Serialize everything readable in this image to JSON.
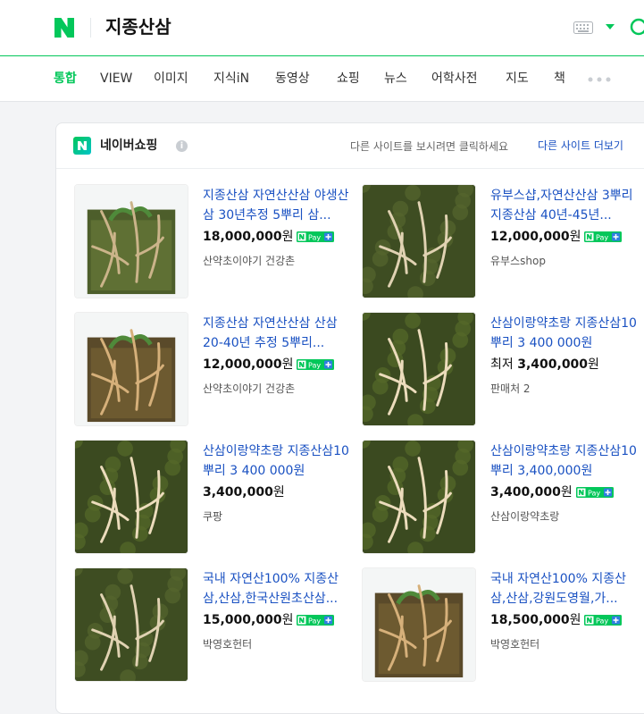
{
  "header": {
    "query": "지종산삼"
  },
  "tabs": [
    "통합",
    "VIEW",
    "이미지",
    "지식iN",
    "동영상",
    "쇼핑",
    "뉴스",
    "어학사전",
    "지도",
    "책"
  ],
  "shopping": {
    "title": "네이버쇼핑",
    "info_glyph": "i",
    "other_sites_hint": "다른 사이트를 보시려면 클릭하세요",
    "other_sites_link": "다른 사이트 더보기",
    "currency": "원",
    "lowest_label": "최저",
    "pay_label": "Pay",
    "products": [
      {
        "title": "지종산삼 자연산산삼 야생산삼 30년추정 5뿌리 삼...",
        "price": "18,000,000",
        "npay": true,
        "lowest": false,
        "seller": "산약초이야기 건강촌"
      },
      {
        "title": "유부스샵,자연산산삼 3뿌리 지종산삼 40년-45년...",
        "price": "12,000,000",
        "npay": true,
        "lowest": false,
        "seller": "유부스shop"
      },
      {
        "title": "지종산삼 자연산산삼 산삼 20-40년 추정 5뿌리...",
        "price": "12,000,000",
        "npay": true,
        "lowest": false,
        "seller": "산약초이야기 건강촌"
      },
      {
        "title": "산삼이랑약초랑 지종산삼10뿌리 3 400 000원",
        "price": "3,400,000",
        "npay": false,
        "lowest": true,
        "seller": "판매처 2"
      },
      {
        "title": "산삼이랑약초랑 지종산삼10뿌리 3 400 000원",
        "price": "3,400,000",
        "npay": false,
        "lowest": false,
        "seller": "쿠팡"
      },
      {
        "title": "산삼이랑약초랑 지종산삼10뿌리 3,400,000원",
        "price": "3,400,000",
        "npay": true,
        "lowest": false,
        "seller": "산삼이랑약초랑"
      },
      {
        "title": "국내 자연산100% 지종산삼,산삼,한국산원초산삼...",
        "price": "15,000,000",
        "npay": true,
        "lowest": false,
        "seller": "박영호헌터"
      },
      {
        "title": "국내 자연산100% 지종산삼,산삼,강원도영월,가...",
        "price": "18,500,000",
        "npay": true,
        "lowest": false,
        "seller": "박영호헌터"
      }
    ]
  },
  "colors": {
    "naver_green": "#03c75a",
    "link_blue": "#1a51c2"
  },
  "icons": [
    "naver-logo-icon",
    "keyboard-icon",
    "chevron-down-icon",
    "search-icon",
    "more-dots-icon",
    "naver-shopping-logo-icon",
    "info-icon",
    "npay-icon"
  ]
}
